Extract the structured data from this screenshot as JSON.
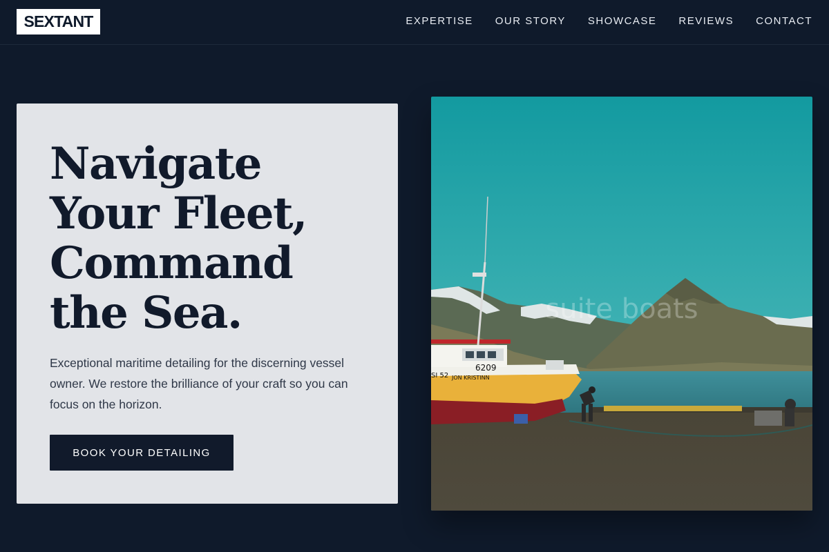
{
  "brand": {
    "logo": "SEXTANT"
  },
  "nav": {
    "items": [
      {
        "label": "EXPERTISE"
      },
      {
        "label": "OUR STORY"
      },
      {
        "label": "SHOWCASE"
      },
      {
        "label": "REVIEWS"
      },
      {
        "label": "CONTACT"
      }
    ]
  },
  "hero": {
    "title": "Navigate Your Fleet, Command the Sea.",
    "subtitle": "Exceptional maritime detailing for the discerning vessel owner. We restore the brilliance of your craft so you can focus on the horizon.",
    "cta_label": "BOOK YOUR DETAILING"
  },
  "photo": {
    "watermark": "suite boats",
    "boat_number": "6209",
    "boat_registration": "SI 52",
    "boat_name": "JON KRISTINN"
  },
  "colors": {
    "page_bg": "#0f1a2b",
    "card_bg": "#e2e4e8",
    "ink": "#111a2b",
    "logo_bg": "#ffffff"
  }
}
